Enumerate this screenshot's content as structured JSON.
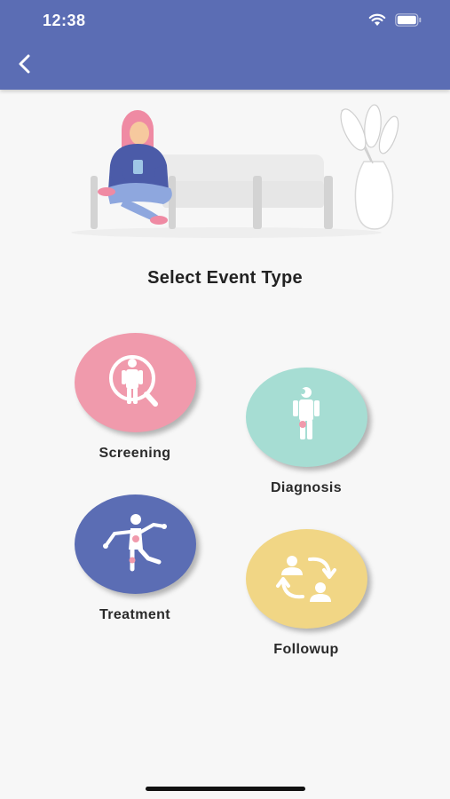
{
  "status_bar": {
    "time": "12:38",
    "icons": [
      "wifi-icon",
      "battery-icon"
    ]
  },
  "header": {
    "back_icon": "chevron-left-icon"
  },
  "page": {
    "title": "Select Event Type"
  },
  "events": [
    {
      "label": "Screening",
      "color": "#f09aac",
      "icon": "screening-icon"
    },
    {
      "label": "Diagnosis",
      "color": "#a6ddd3",
      "icon": "diagnosis-icon"
    },
    {
      "label": "Treatment",
      "color": "#5b6db4",
      "icon": "treatment-icon"
    },
    {
      "label": "Followup",
      "color": "#f1d685",
      "icon": "followup-icon"
    }
  ],
  "colors": {
    "app_bar": "#5b6db4",
    "background": "#f7f7f7"
  }
}
